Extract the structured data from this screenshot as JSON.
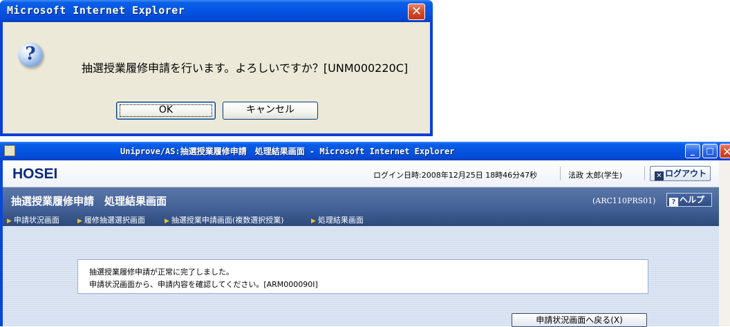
{
  "dialog": {
    "title": "Microsoft Internet Explorer",
    "message": "抽選授業履修申請を行います。よろしいですか？[UNM000220C]",
    "ok_label": "OK",
    "cancel_label": "キャンセル",
    "close_glyph": "✕",
    "icon": "question-icon"
  },
  "window": {
    "title": "Uniprove/AS:抽選授業履修申請　処理結果画面 - Microsoft Internet Explorer",
    "minimize_glyph": "_",
    "maximize_glyph": "□",
    "close_glyph": "✕"
  },
  "header": {
    "logo": "HOSEI",
    "login_info": "ログイン日時:2008年12月25日 18時46分47秒",
    "user_name": "法政 太郎(学生)",
    "logout_label": "ログアウト",
    "logout_icon_glyph": "✕"
  },
  "title_bar": {
    "title": "抽選授業履修申請　処理結果画面",
    "screen_id": "(ARC110PRS01)",
    "help_label": "ヘルプ",
    "help_icon_glyph": "?"
  },
  "breadcrumbs": [
    "申請状況画面",
    "履修抽選選択画面",
    "抽選授業申請画面(複数選択授業)",
    "処理結果画面"
  ],
  "message": {
    "line1": "抽選授業履修申請が正常に完了しました。",
    "line2": "申請状況画面から、申請内容を確認してください。[ARM000090I]"
  },
  "back_button_label": "申請状況画面へ戻る(X)",
  "colors": {
    "xp_title_blue": "#0554e2",
    "xp_close_red": "#d64a2a",
    "dialog_face": "#ece9d8",
    "page_title_bar": "#4a6aa0",
    "breadcrumb_bar": "#2e4a7c",
    "content_bg": "#dde6f3"
  }
}
